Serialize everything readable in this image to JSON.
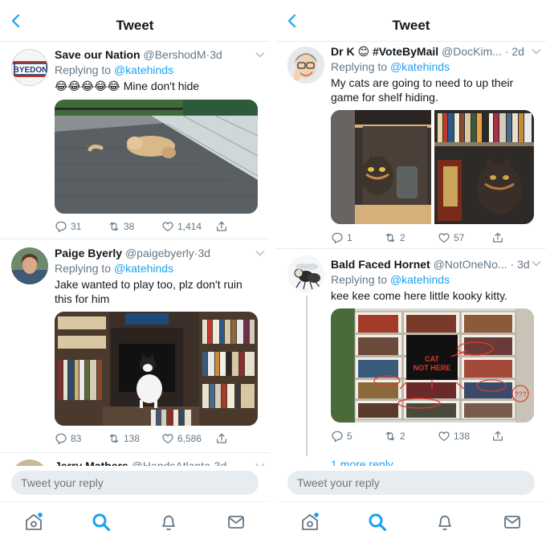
{
  "left": {
    "header": {
      "title": "Tweet"
    },
    "tweets": [
      {
        "name": "Save our Nation",
        "handle": "@BershodM",
        "time": "3d",
        "replying_prefix": "Replying to",
        "replying_to": "@katehinds",
        "emoji": "😂😂😂😂😂",
        "text": "Mine don't hide",
        "avatar_text": "BYEDON",
        "replies": "31",
        "retweets": "38",
        "likes": "1,414"
      },
      {
        "name": "Paige Byerly",
        "handle": "@paigebyerly",
        "time": "3d",
        "replying_prefix": "Replying to",
        "replying_to": "@katehinds",
        "text": "Jake wanted to play too, plz don't ruin this for him",
        "replies": "83",
        "retweets": "138",
        "likes": "6,586"
      },
      {
        "name": "Jerry Mathers",
        "handle": "@HandsAtlanta",
        "time": "3d"
      }
    ],
    "reply": {
      "placeholder": "Tweet your reply"
    }
  },
  "right": {
    "header": {
      "title": "Tweet"
    },
    "tweets": [
      {
        "name": "Dr K",
        "name_suffix": "#VoteByMail",
        "handle": "@DocKim...",
        "time": "2d",
        "replying_prefix": "Replying to",
        "replying_to": "@katehinds",
        "text": "My cats are going to need to up their game for shelf hiding.",
        "replies": "1",
        "retweets": "2",
        "likes": "57"
      },
      {
        "name": "Bald Faced Hornet",
        "handle": "@NotOneNo...",
        "time": "3d",
        "replying_prefix": "Replying to",
        "replying_to": "@katehinds",
        "text": "kee kee come here little kooky kitty.",
        "image_label_1": "CAT",
        "image_label_2": "NOT HERE",
        "image_qmarks": "???",
        "replies": "5",
        "retweets": "2",
        "likes": "138"
      }
    ],
    "more_replies": "1 more reply",
    "reply": {
      "placeholder": "Tweet your reply"
    }
  },
  "colors": {
    "accent": "#1da1f2",
    "muted": "#657786",
    "border": "#e6ecf0"
  },
  "icons": [
    "back-chevron-icon",
    "caret-down-icon",
    "reply-icon",
    "retweet-icon",
    "like-icon",
    "share-icon",
    "home-icon",
    "search-icon",
    "notifications-icon",
    "messages-icon"
  ]
}
